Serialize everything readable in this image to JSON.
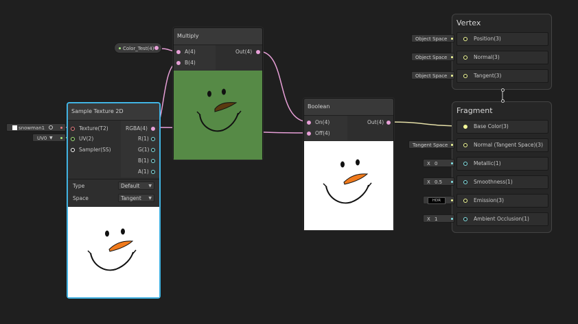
{
  "colors": {
    "canvas": "#1f1f1f",
    "node_bg": "#2e2e2e",
    "selected_border": "#44c0f0",
    "port_texture": "#e87c82",
    "port_vector4": "#e8a0d8",
    "port_vector2": "#a4e87c",
    "port_vector3": "#f6ff9a",
    "port_float": "#84e4e7",
    "port_sampler": "#ffffff",
    "multiply_preview_bg": "#568a46",
    "nose_orange": "#f07a1c",
    "nose_brown": "#5a3a10"
  },
  "property_node": {
    "label": "Color_Test(4)"
  },
  "multiply": {
    "title": "Multiply",
    "inputs": [
      "A(4)",
      "B(4)"
    ],
    "output": "Out(4)"
  },
  "sample_texture": {
    "title": "Sample Texture 2D",
    "inputs": [
      "Texture(T2)",
      "UV(2)",
      "Sampler(SS)"
    ],
    "outputs": [
      "RGBA(4)",
      "R(1)",
      "G(1)",
      "B(1)",
      "A(1)"
    ],
    "type_label": "Type",
    "type_value": "Default",
    "space_label": "Space",
    "space_value": "Tangent",
    "texture_field": "snowman1",
    "uv_field": "UV0"
  },
  "boolean": {
    "title": "Boolean",
    "inputs": [
      "On(4)",
      "Off(4)"
    ],
    "output": "Out(4)"
  },
  "vertex": {
    "title": "Vertex",
    "slots": [
      {
        "label": "Position(3)",
        "field": "Object Space"
      },
      {
        "label": "Normal(3)",
        "field": "Object Space"
      },
      {
        "label": "Tangent(3)",
        "field": "Object Space"
      }
    ]
  },
  "fragment": {
    "title": "Fragment",
    "slots": [
      {
        "label": "Base Color(3)",
        "field_kind": "connected"
      },
      {
        "label": "Normal (Tangent Space)(3)",
        "field_kind": "text",
        "field": "Tangent Space"
      },
      {
        "label": "Metallic(1)",
        "field_kind": "number",
        "axis": "X",
        "value": "0"
      },
      {
        "label": "Smoothness(1)",
        "field_kind": "number",
        "axis": "X",
        "value": "0.5"
      },
      {
        "label": "Emission(3)",
        "field_kind": "hdr",
        "value": "HDR"
      },
      {
        "label": "Ambient Occlusion(1)",
        "field_kind": "number",
        "axis": "X",
        "value": "1"
      }
    ]
  }
}
